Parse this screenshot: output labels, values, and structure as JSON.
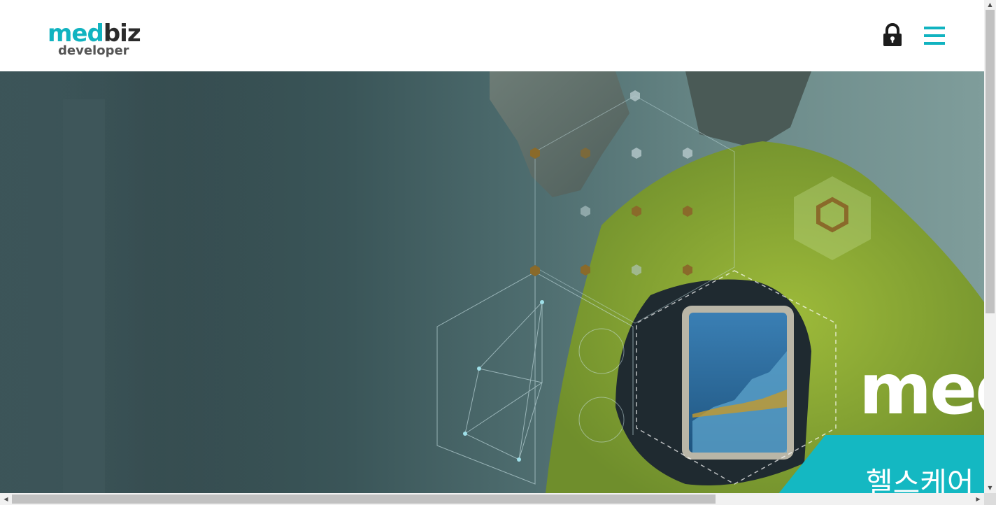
{
  "header": {
    "logo": {
      "primary_part1": "med",
      "primary_part2": "biz",
      "secondary": "developer"
    },
    "lock_icon": "lock-icon",
    "menu_icon": "hamburger-menu-icon"
  },
  "hero": {
    "title": "med",
    "subtitle": "헬스케어",
    "image_description_icon": "athlete-armband-phone-icon"
  },
  "colors": {
    "brand_teal": "#11b3c0",
    "brand_dark": "#2b2b2b",
    "band_teal": "#14b8c2"
  }
}
